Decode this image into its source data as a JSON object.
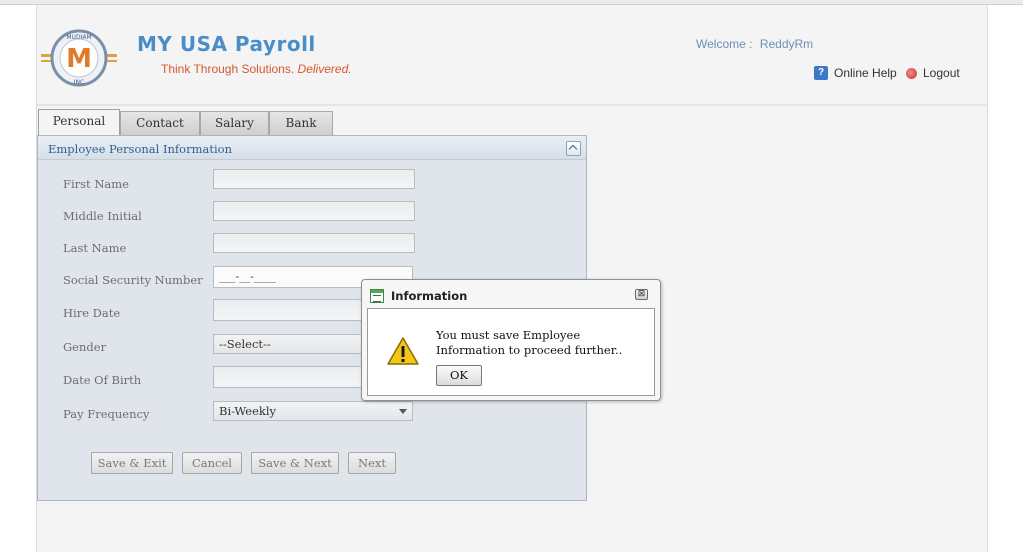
{
  "header": {
    "app_title": "MY USA Payroll",
    "tagline_main": "Think Through Solutions.",
    "tagline_em": "Delivered.",
    "welcome_label": "Welcome :",
    "username": "ReddyRm",
    "online_help_label": "Online Help",
    "logout_label": "Logout",
    "logo_icon": "mudiam-inc-logo",
    "brand_color": "#4a8ec8",
    "tagline_color": "#d8572d"
  },
  "tabs": [
    {
      "label": "Personal",
      "active": true
    },
    {
      "label": "Contact",
      "active": false
    },
    {
      "label": "Salary",
      "active": false
    },
    {
      "label": "Bank",
      "active": false
    }
  ],
  "panel": {
    "title": "Employee Personal Information",
    "collapse_icon": "chevron-up-icon"
  },
  "form": {
    "fields": [
      {
        "label": "First Name",
        "value": ""
      },
      {
        "label": "Middle Initial",
        "value": ""
      },
      {
        "label": "Last Name",
        "value": ""
      },
      {
        "label": "Social Security Number",
        "value": "___-__-____"
      },
      {
        "label": "Hire Date",
        "value": ""
      },
      {
        "label": "Gender",
        "value": "--Select--"
      },
      {
        "label": "Date Of Birth",
        "value": ""
      },
      {
        "label": "Pay Frequency",
        "value": "Bi-Weekly"
      }
    ],
    "buttons": {
      "save_exit": "Save & Exit",
      "cancel": "Cancel",
      "save_next": "Save & Next",
      "next": "Next"
    }
  },
  "dialog": {
    "title": "Information",
    "message": "You must save Employee Information to proceed further..",
    "ok_label": "OK",
    "close_glyph": "⊠",
    "icon": "warning-icon"
  }
}
